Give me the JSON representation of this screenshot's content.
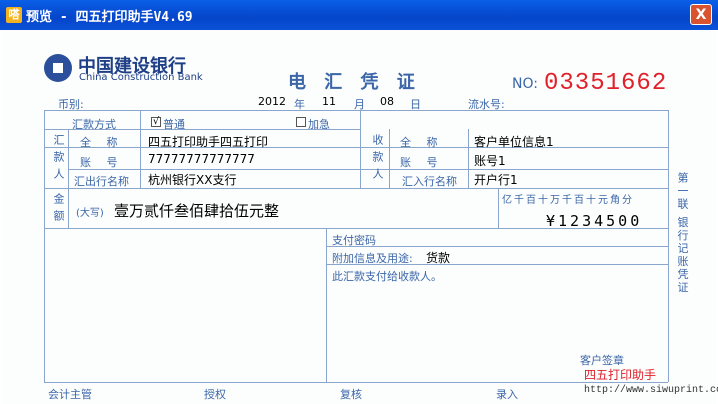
{
  "window": {
    "title": "预览 - 四五打印助手V4.69",
    "close_label": "X"
  },
  "bank": {
    "name_cn": "中国建设银行",
    "name_en": "China Construction Bank"
  },
  "doc": {
    "title": "电 汇 凭 证",
    "no_label": "NO:",
    "serial": "03351662"
  },
  "header": {
    "currency_label": "币别:",
    "year": "2012",
    "year_label": "年",
    "month": "11",
    "month_label": "月",
    "day": "08",
    "day_label": "日",
    "flow_label": "流水号:"
  },
  "method": {
    "label": "汇款方式",
    "opt1": "普通",
    "opt2": "加急",
    "check_mark": "√"
  },
  "remitter": {
    "side_label": "汇款人",
    "name_label": "全  称",
    "name": "四五打印助手四五打印",
    "account_label": "账  号",
    "account": "77777777777777",
    "bank_label": "汇出行名称",
    "bank": "杭州银行XX支行"
  },
  "payee": {
    "side_label": "收款人",
    "name_label": "全  称",
    "name": "客户单位信息1",
    "account_label": "账  号",
    "account": "账号1",
    "bank_label": "汇入行名称",
    "bank": "开户行1"
  },
  "amount": {
    "side_label": "金额",
    "caps_label": "(大写)",
    "caps": "壹万贰仟叁佰肆拾伍元整",
    "units": "亿千百十万千百十元角分",
    "digits": "¥1234500"
  },
  "extra": {
    "pwd_label": "支付密码",
    "info_label": "附加信息及用途:",
    "info": "货款",
    "note": "此汇款支付给收款人。",
    "sign_label": "客户签章"
  },
  "footer": {
    "f1": "会计主管",
    "f2": "授权",
    "f3": "复核",
    "f4": "录入"
  },
  "side_note": "第一联 银行记账凭证",
  "watermark": {
    "text": "四五打印助手",
    "url": "http://www.siwuprint.com"
  }
}
